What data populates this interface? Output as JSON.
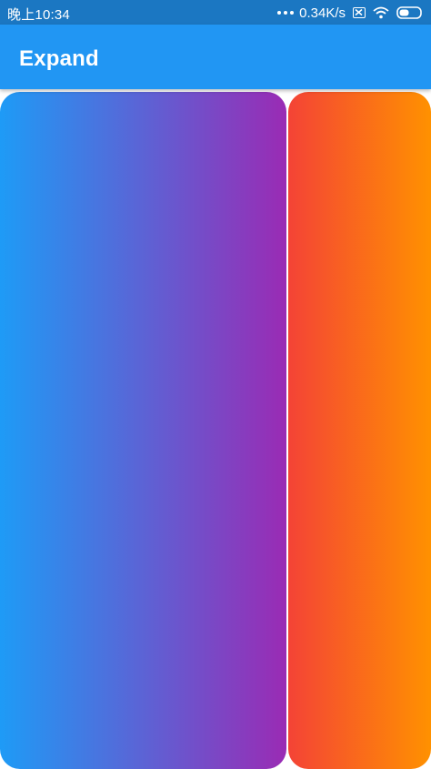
{
  "status_bar": {
    "time": "晚上10:34",
    "net_speed": "0.34K/s",
    "icons": [
      "more-dots-icon",
      "no-sim-icon",
      "wifi-icon",
      "battery-icon"
    ]
  },
  "app_bar": {
    "title": "Expand",
    "color": "#2196f3"
  },
  "panels": [
    {
      "name": "left-expanded-panel",
      "gradient": [
        "#1e9bf6",
        "#9a2bb4"
      ]
    },
    {
      "name": "right-expanded-panel",
      "gradient": [
        "#f44336",
        "#ff9100"
      ]
    }
  ]
}
